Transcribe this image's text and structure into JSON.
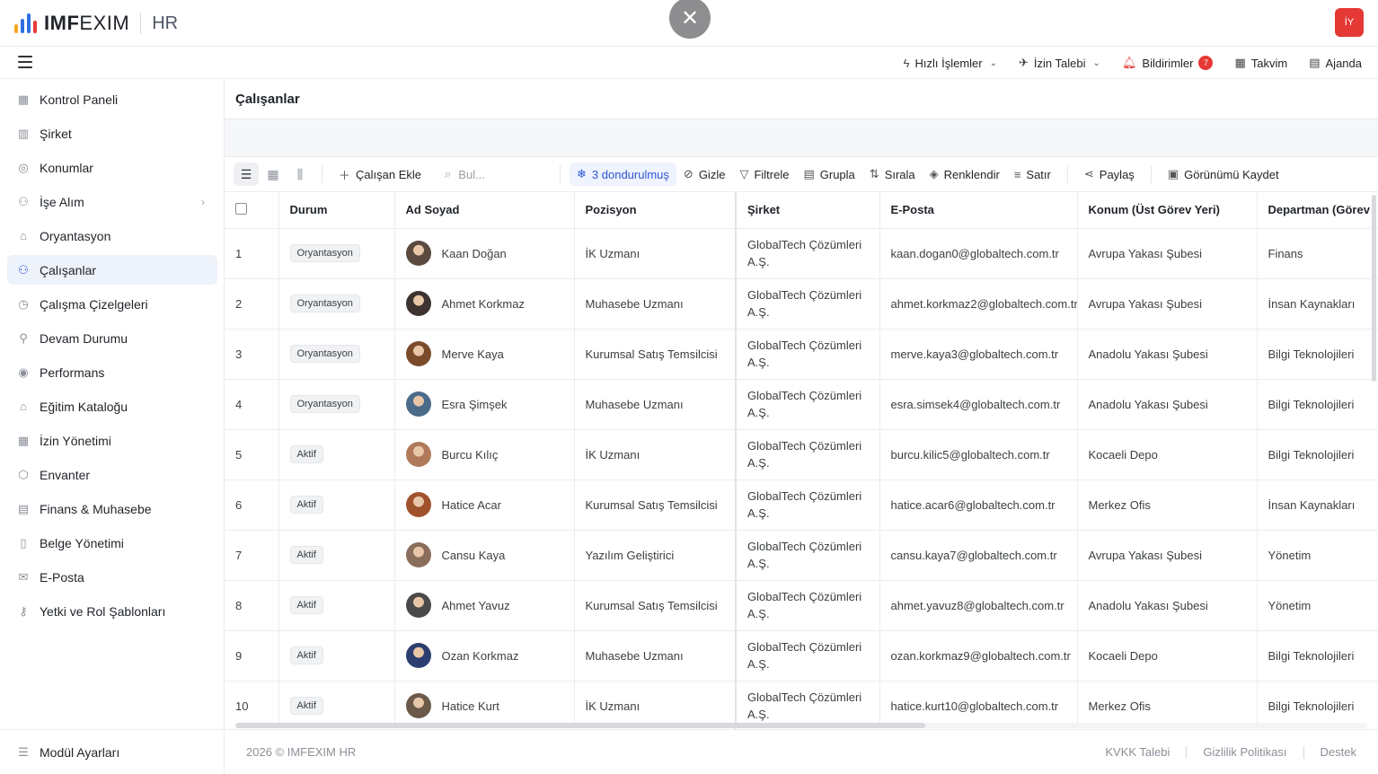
{
  "app": {
    "logo_text_bold": "IMF",
    "logo_text_light": "EXIM",
    "logo_suffix": "HR",
    "logo_colors": [
      "#f5a623",
      "#2f6fe0",
      "#2f6fe0",
      "#e53935"
    ],
    "user_initials": "İY",
    "accent": "#2f55d4",
    "danger": "#e53935"
  },
  "topnav": {
    "quick_actions": "Hızlı İşlemler",
    "leave_request": "İzin Talebi",
    "notifications": "Bildirimler",
    "notifications_count": "7",
    "calendar": "Takvim",
    "agenda": "Ajanda"
  },
  "sidebar": {
    "items": [
      {
        "label": "Kontrol Paneli",
        "icon": "dashboard-icon"
      },
      {
        "label": "Şirket",
        "icon": "building-icon"
      },
      {
        "label": "Konumlar",
        "icon": "location-pin-icon"
      },
      {
        "label": "İşe Alım",
        "icon": "user-plus-icon"
      },
      {
        "label": "Oryantasyon",
        "icon": "graduation-cap-icon"
      },
      {
        "label": "Çalışanlar",
        "icon": "users-icon"
      },
      {
        "label": "Çalışma Çizelgeleri",
        "icon": "clock-icon"
      },
      {
        "label": "Devam Durumu",
        "icon": "user-check-icon"
      },
      {
        "label": "Performans",
        "icon": "target-icon"
      },
      {
        "label": "Eğitim Kataloğu",
        "icon": "graduation-cap-icon"
      },
      {
        "label": "İzin Yönetimi",
        "icon": "calendar-icon"
      },
      {
        "label": "Envanter",
        "icon": "box-icon"
      },
      {
        "label": "Finans & Muhasebe",
        "icon": "receipt-icon"
      },
      {
        "label": "Belge Yönetimi",
        "icon": "document-icon"
      },
      {
        "label": "E-Posta",
        "icon": "mail-icon"
      },
      {
        "label": "Yetki ve Rol Şablonları",
        "icon": "key-icon"
      }
    ],
    "footer_label": "Modül Ayarları"
  },
  "page": {
    "title": "Çalışanlar"
  },
  "toolbar": {
    "add_employee": "Çalışan Ekle",
    "search_placeholder": "Bul...",
    "frozen": "3 dondurulmuş",
    "hide": "Gizle",
    "filter": "Filtrele",
    "group": "Grupla",
    "sort": "Sırala",
    "colorize": "Renklendir",
    "row": "Satır",
    "share": "Paylaş",
    "save_view": "Görünümü Kaydet"
  },
  "table": {
    "columns": [
      "Durum",
      "Ad Soyad",
      "Pozisyon",
      "Şirket",
      "E-Posta",
      "Konum (Üst Görev Yeri)",
      "Departman (Görev"
    ],
    "rows": [
      {
        "no": "1",
        "status": "Oryantasyon",
        "name": "Kaan Doğan",
        "position": "İK Uzmanı",
        "company": "GlobalTech Çözümleri A.Ş.",
        "email": "kaan.dogan0@globaltech.com.tr",
        "location": "Avrupa Yakası Şubesi",
        "department": "Finans"
      },
      {
        "no": "2",
        "status": "Oryantasyon",
        "name": "Ahmet Korkmaz",
        "position": "Muhasebe Uzmanı",
        "company": "GlobalTech Çözümleri A.Ş.",
        "email": "ahmet.korkmaz2@globaltech.com.tr",
        "location": "Avrupa Yakası Şubesi",
        "department": "İnsan Kaynakları"
      },
      {
        "no": "3",
        "status": "Oryantasyon",
        "name": "Merve Kaya",
        "position": "Kurumsal Satış Temsilcisi",
        "company": "GlobalTech Çözümleri A.Ş.",
        "email": "merve.kaya3@globaltech.com.tr",
        "location": "Anadolu Yakası Şubesi",
        "department": "Bilgi Teknolojileri"
      },
      {
        "no": "4",
        "status": "Oryantasyon",
        "name": "Esra Şimşek",
        "position": "Muhasebe Uzmanı",
        "company": "GlobalTech Çözümleri A.Ş.",
        "email": "esra.simsek4@globaltech.com.tr",
        "location": "Anadolu Yakası Şubesi",
        "department": "Bilgi Teknolojileri"
      },
      {
        "no": "5",
        "status": "Aktif",
        "name": "Burcu Kılıç",
        "position": "İK Uzmanı",
        "company": "GlobalTech Çözümleri A.Ş.",
        "email": "burcu.kilic5@globaltech.com.tr",
        "location": "Kocaeli Depo",
        "department": "Bilgi Teknolojileri"
      },
      {
        "no": "6",
        "status": "Aktif",
        "name": "Hatice Acar",
        "position": "Kurumsal Satış Temsilcisi",
        "company": "GlobalTech Çözümleri A.Ş.",
        "email": "hatice.acar6@globaltech.com.tr",
        "location": "Merkez Ofis",
        "department": "İnsan Kaynakları"
      },
      {
        "no": "7",
        "status": "Aktif",
        "name": "Cansu Kaya",
        "position": "Yazılım Geliştirici",
        "company": "GlobalTech Çözümleri A.Ş.",
        "email": "cansu.kaya7@globaltech.com.tr",
        "location": "Avrupa Yakası Şubesi",
        "department": "Yönetim"
      },
      {
        "no": "8",
        "status": "Aktif",
        "name": "Ahmet Yavuz",
        "position": "Kurumsal Satış Temsilcisi",
        "company": "GlobalTech Çözümleri A.Ş.",
        "email": "ahmet.yavuz8@globaltech.com.tr",
        "location": "Anadolu Yakası Şubesi",
        "department": "Yönetim"
      },
      {
        "no": "9",
        "status": "Aktif",
        "name": "Ozan Korkmaz",
        "position": "Muhasebe Uzmanı",
        "company": "GlobalTech Çözümleri A.Ş.",
        "email": "ozan.korkmaz9@globaltech.com.tr",
        "location": "Kocaeli Depo",
        "department": "Bilgi Teknolojileri"
      },
      {
        "no": "10",
        "status": "Aktif",
        "name": "Hatice Kurt",
        "position": "İK Uzmanı",
        "company": "GlobalTech Çözümleri A.Ş.",
        "email": "hatice.kurt10@globaltech.com.tr",
        "location": "Merkez Ofis",
        "department": "Bilgi Teknolojileri"
      }
    ],
    "avatar_colors": [
      "#5b4a3f",
      "#3d3330",
      "#7a4b2a",
      "#4a6b8a",
      "#b07a5a",
      "#a0522d",
      "#8a6d5a",
      "#4a4a4a",
      "#2c3e70",
      "#6b5a4a"
    ]
  },
  "footer": {
    "copyright": "2026 © IMFEXIM HR",
    "kvkk": "KVKK Talebi",
    "privacy": "Gizlilik Politikası",
    "support": "Destek"
  }
}
